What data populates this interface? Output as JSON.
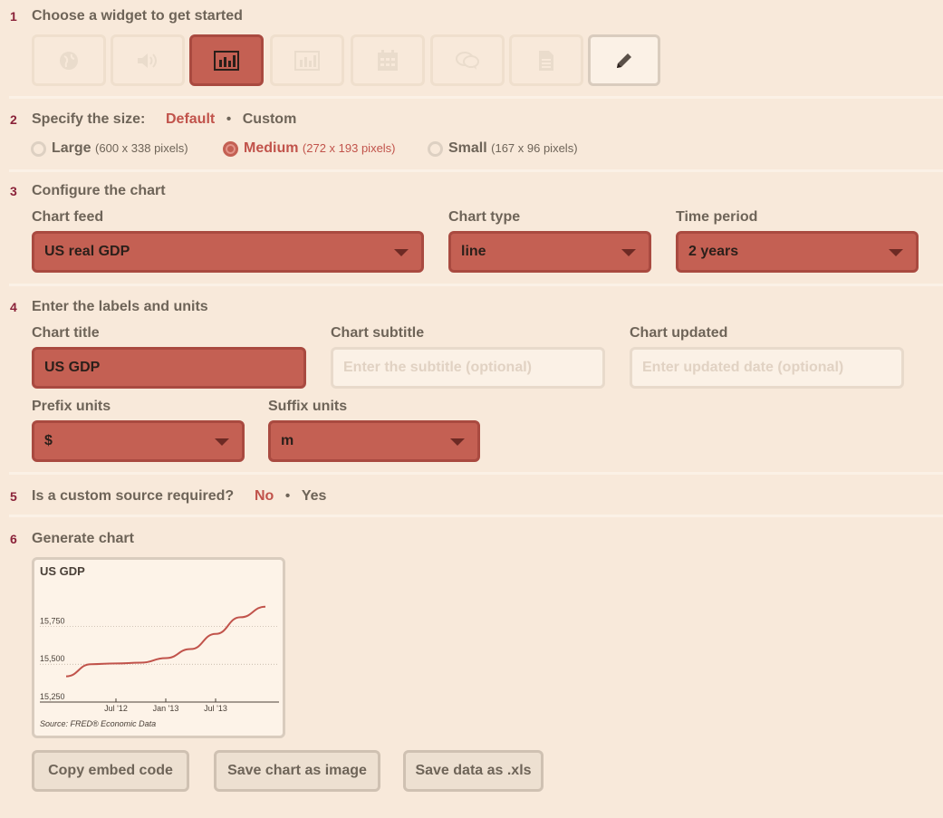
{
  "steps": {
    "s1": {
      "num": "1",
      "title": "Choose a widget to get started"
    },
    "s2": {
      "num": "2",
      "title": "Specify the size:",
      "default_label": "Default",
      "separator": "•",
      "custom_label": "Custom"
    },
    "s3": {
      "num": "3",
      "title": "Configure the chart"
    },
    "s4": {
      "num": "4",
      "title": "Enter the labels and units"
    },
    "s5": {
      "num": "5",
      "title": "Is a custom source required?",
      "no_label": "No",
      "separator": "•",
      "yes_label": "Yes"
    },
    "s6": {
      "num": "6",
      "title": "Generate chart"
    }
  },
  "widgets": [
    {
      "icon": "globe-icon",
      "active": false
    },
    {
      "icon": "speaker-icon",
      "active": false
    },
    {
      "icon": "bar-chart-icon",
      "active": true
    },
    {
      "icon": "bar-chart-outline-icon",
      "active": false
    },
    {
      "icon": "calendar-icon",
      "active": false
    },
    {
      "icon": "speech-bubbles-icon",
      "active": false
    },
    {
      "icon": "document-icon",
      "active": false
    },
    {
      "icon": "pencil-icon",
      "active": false
    }
  ],
  "size_options": {
    "large": {
      "label": "Large",
      "dims": "(600 x 338 pixels)"
    },
    "medium": {
      "label": "Medium",
      "dims": "(272 x 193 pixels)",
      "selected": true
    },
    "small": {
      "label": "Small",
      "dims": "(167 x 96 pixels)"
    }
  },
  "configure": {
    "feed_label": "Chart feed",
    "feed_value": "US real GDP",
    "type_label": "Chart type",
    "type_value": "line",
    "period_label": "Time period",
    "period_value": "2 years"
  },
  "labels": {
    "title_label": "Chart title",
    "title_value": "US GDP",
    "subtitle_label": "Chart subtitle",
    "subtitle_placeholder": "Enter the subtitle (optional)",
    "updated_label": "Chart updated",
    "updated_placeholder": "Enter updated date (optional)",
    "prefix_label": "Prefix units",
    "prefix_value": "$",
    "suffix_label": "Suffix units",
    "suffix_value": "m"
  },
  "chart_data": {
    "type": "line",
    "title": "US GDP",
    "source": "Source: FRED® Economic Data",
    "ylim": [
      15250,
      15950
    ],
    "yticks": [
      "15,250",
      "15,500",
      "15,750"
    ],
    "xticks": [
      "Jul '12",
      "Jan '13",
      "Jul '13"
    ],
    "x": [
      "Jan '12",
      "Apr '12",
      "Jul '12",
      "Oct '12",
      "Jan '13",
      "Apr '13",
      "Jul '13",
      "Oct '13",
      "Jan '14"
    ],
    "series": [
      {
        "values": [
          15420,
          15500,
          15505,
          15510,
          15540,
          15600,
          15700,
          15810,
          15880
        ]
      }
    ],
    "colors": {
      "line": "#c1534b"
    },
    "grid": true
  },
  "actions": {
    "copy": "Copy embed code",
    "save_image": "Save chart as image",
    "save_xls": "Save data as .xls"
  }
}
